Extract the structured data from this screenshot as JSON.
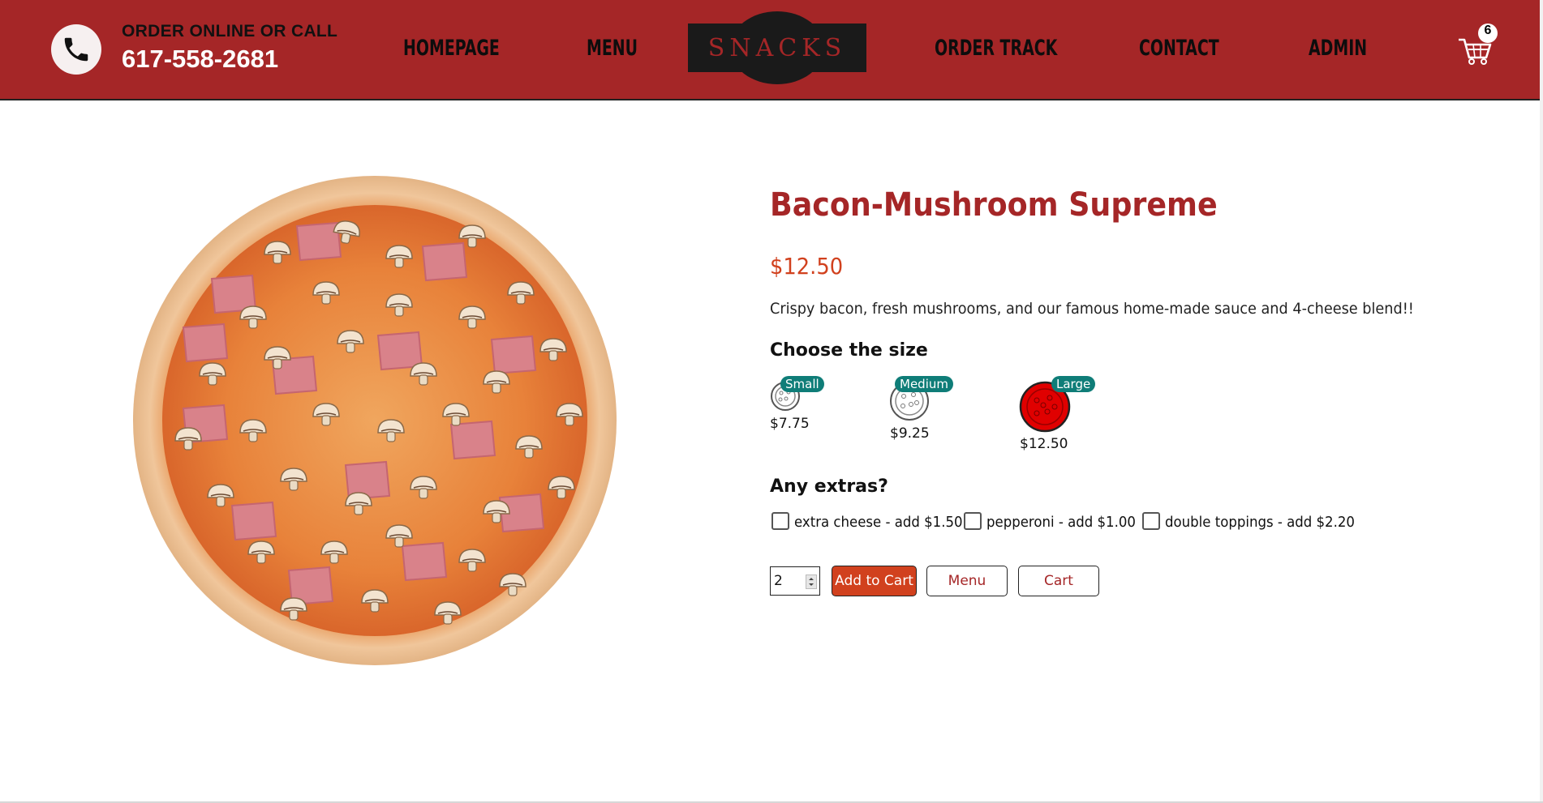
{
  "header": {
    "call_label": "ORDER ONLINE OR CALL",
    "phone": "617-558-2681",
    "logo_text": "SNACKS",
    "nav": [
      "HOMEPAGE",
      "MENU",
      "ORDER TRACK",
      "CONTACT",
      "ADMIN"
    ],
    "cart_count": "6",
    "icons": {
      "phone": "phone-icon",
      "cart": "cart-icon"
    }
  },
  "product": {
    "title": "Bacon-Mushroom Supreme",
    "price": "$12.50",
    "description": "Crispy bacon, fresh mushrooms, and our famous home-made sauce and 4-cheese blend!!",
    "size_heading": "Choose the size",
    "sizes": [
      {
        "label": "Small",
        "price": "$7.75"
      },
      {
        "label": "Medium",
        "price": "$9.25"
      },
      {
        "label": "Large",
        "price": "$12.50",
        "selected": true
      }
    ],
    "extras_heading": "Any extras?",
    "extras": [
      {
        "label": "extra cheese - add $1.50",
        "checked": false
      },
      {
        "label": "pepperoni - add $1.00",
        "checked": false
      },
      {
        "label": "double toppings - add $2.20",
        "checked": false
      }
    ],
    "quantity": "2",
    "buttons": {
      "add": "Add to Cart",
      "menu": "Menu",
      "cart": "Cart"
    }
  },
  "colors": {
    "header_bg": "#a52627",
    "title": "#a52627",
    "price": "#d1411e",
    "add_button": "#d1411e",
    "badge": "#0f7d78",
    "selected_size": "#e00000"
  }
}
